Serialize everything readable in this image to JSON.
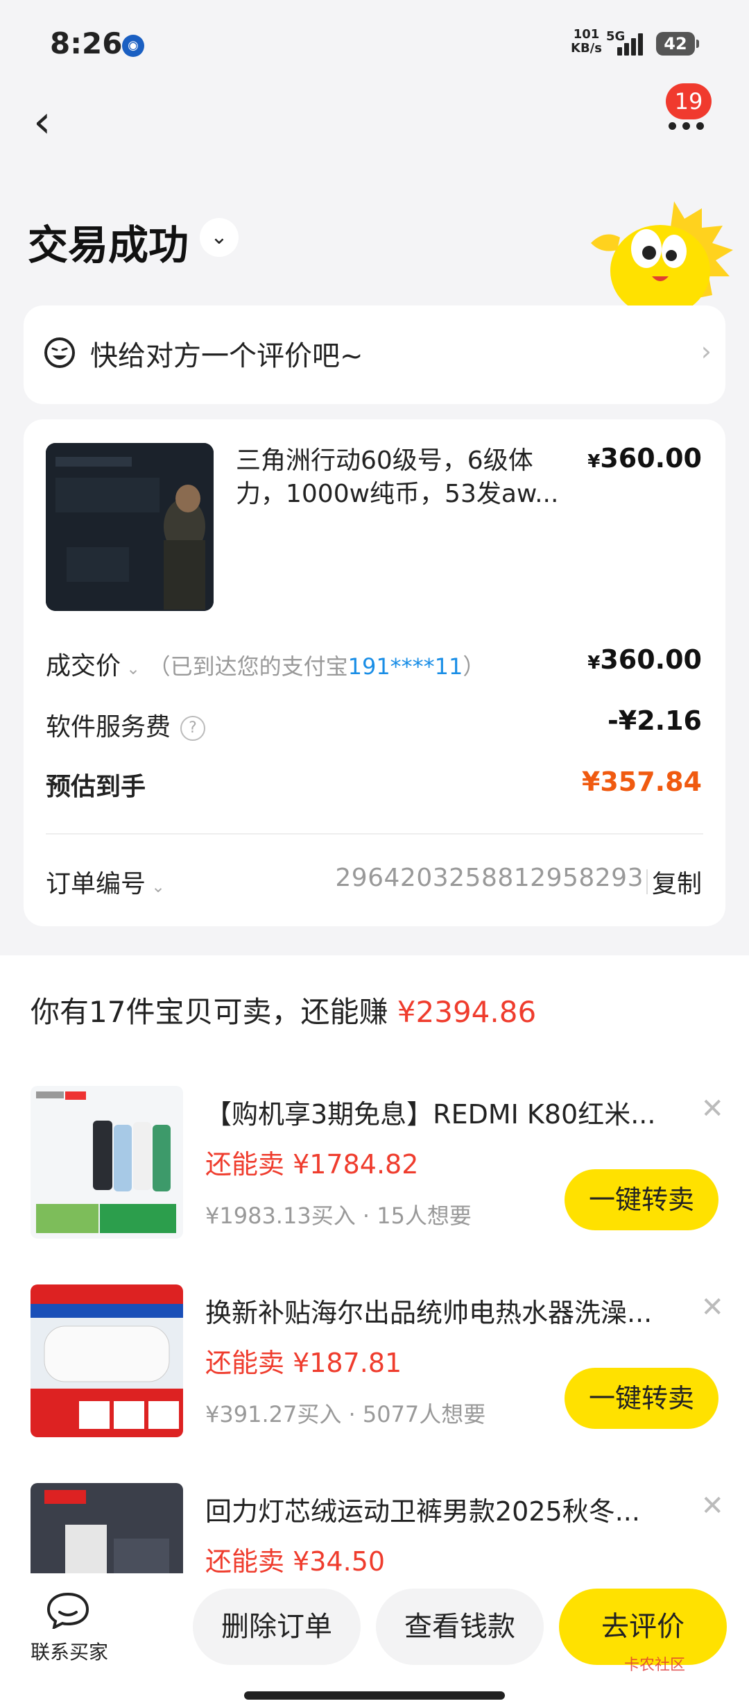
{
  "status": {
    "time": "8:26",
    "net_speed": "101",
    "net_unit": "KB/s",
    "network": "5G",
    "battery": "42"
  },
  "header": {
    "notification_count": "19"
  },
  "order_status": {
    "title": "交易成功"
  },
  "review_prompt": {
    "text": "快给对方一个评价吧~"
  },
  "order": {
    "item_title": "三角洲行动60级号，6级体力，1000w纯币，53发aw...",
    "item_price": "360.00",
    "currency": "¥",
    "deal_price_label": "成交价",
    "deal_note_prefix": "（已到达您的支付宝",
    "deal_note_account": "191****11",
    "deal_note_suffix": "）",
    "deal_price": "360.00",
    "service_fee_label": "软件服务费",
    "service_fee": "-¥2.16",
    "estimated_label": "预估到手",
    "estimated": "¥357.84",
    "order_no_label": "订单编号",
    "order_no": "2964203258812958293",
    "copy_label": "复制"
  },
  "sell_more": {
    "text": "你有17件宝贝可卖，还能赚 ",
    "amount": "¥2394.86"
  },
  "products": [
    {
      "title": "【购机享3期免息】REDMI K80红米...",
      "price": "还能卖 ¥1784.82",
      "meta": "¥1983.13买入 · 15人想要",
      "button": "一键转卖"
    },
    {
      "title": "换新补贴海尔出品统帅电热水器洗澡...",
      "price": "还能卖 ¥187.81",
      "meta": "¥391.27买入 · 5077人想要",
      "button": "一键转卖"
    },
    {
      "title": "回力灯芯绒运动卫裤男款2025秋冬...",
      "price": "还能卖 ¥34.50"
    }
  ],
  "bottom_bar": {
    "contact": "联系买家",
    "delete": "删除订单",
    "view_money": "查看钱款",
    "review": "去评价",
    "watermark": "卡农社区"
  },
  "colors": {
    "accent_yellow": "#ffe100",
    "price_red": "#ef3c2d",
    "orange": "#f05a10",
    "link_blue": "#1a8ee6"
  }
}
